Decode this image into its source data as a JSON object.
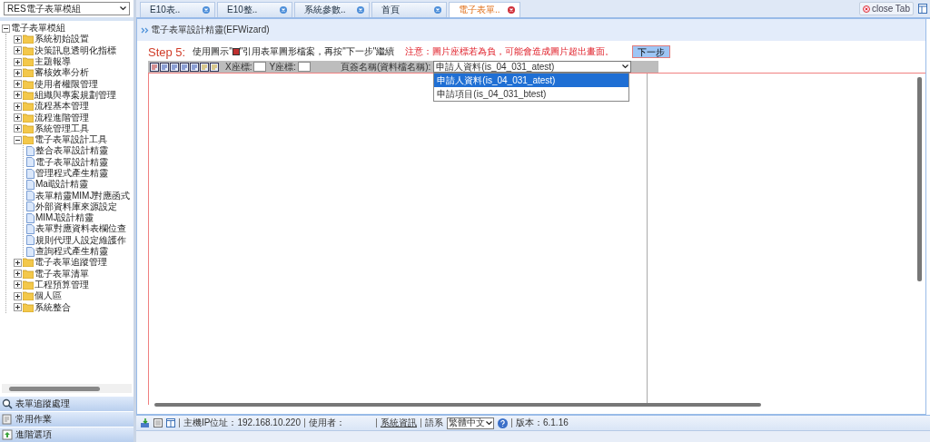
{
  "sidebar": {
    "module_select": "RES電子表單模組",
    "tree": [
      {
        "label": "電子表單模組",
        "kind": "root",
        "expanded": true,
        "children": [
          {
            "label": "系統初始設置",
            "kind": "folder",
            "expanded": false
          },
          {
            "label": "決策訊息透明化指標",
            "kind": "folder",
            "expanded": false
          },
          {
            "label": "主題報導",
            "kind": "folder",
            "expanded": false
          },
          {
            "label": "審核效率分析",
            "kind": "folder",
            "expanded": false
          },
          {
            "label": "使用者權限管理",
            "kind": "folder",
            "expanded": false
          },
          {
            "label": "組織與專案規劃管理",
            "kind": "folder",
            "expanded": false
          },
          {
            "label": "流程基本管理",
            "kind": "folder",
            "expanded": false
          },
          {
            "label": "流程進階管理",
            "kind": "folder",
            "expanded": false
          },
          {
            "label": "系統管理工具",
            "kind": "folder",
            "expanded": false
          },
          {
            "label": "電子表單設計工具",
            "kind": "folder",
            "expanded": true,
            "children": [
              {
                "label": "整合表單設計精靈",
                "kind": "file"
              },
              {
                "label": "電子表單設計精靈",
                "kind": "file"
              },
              {
                "label": "管理程式產生精靈",
                "kind": "file"
              },
              {
                "label": "Mail設計精靈",
                "kind": "file"
              },
              {
                "label": "表單精靈MIMJ對應函式",
                "kind": "file"
              },
              {
                "label": "外部資料庫來源設定",
                "kind": "file"
              },
              {
                "label": "MIMJ設計精靈",
                "kind": "file"
              },
              {
                "label": "表單對應資料表欄位查",
                "kind": "file"
              },
              {
                "label": "規則代理人設定維護作",
                "kind": "file"
              },
              {
                "label": "查詢程式產生精靈",
                "kind": "file"
              }
            ]
          },
          {
            "label": "電子表單追蹤管理",
            "kind": "folder",
            "expanded": false
          },
          {
            "label": "電子表單清單",
            "kind": "folder",
            "expanded": false
          },
          {
            "label": "工程預算管理",
            "kind": "folder",
            "expanded": false
          },
          {
            "label": "個人區",
            "kind": "folder",
            "expanded": false
          },
          {
            "label": "系統整合",
            "kind": "folder",
            "expanded": false
          }
        ]
      }
    ],
    "panels": [
      {
        "label": "表單追蹤處理"
      },
      {
        "label": "常用作業"
      },
      {
        "label": "進階選項"
      }
    ]
  },
  "tabs": [
    {
      "label": "E10表..",
      "selected": false
    },
    {
      "label": "E10整..",
      "selected": false
    },
    {
      "label": "系統參數..",
      "selected": false
    },
    {
      "label": "首頁",
      "selected": false
    },
    {
      "label": "電子表單..",
      "selected": true
    }
  ],
  "close_tab": "close Tab",
  "breadcrumb": "電子表單設計精靈(EFWizard)",
  "step": {
    "label": "Step 5:",
    "instruction_before": "使用圖示\"",
    "instruction_after": "\"引用表單圖形檔案，再按\"下一步\"繼續",
    "warning": "注意：圖片座標若為負，可能會造成圖片超出畫面。",
    "next_button": "下一步"
  },
  "toolbar": {
    "x_label": "X座標:",
    "y_label": "Y座標:",
    "sheet_label": "頁簽名稱(資料檔名稱):",
    "sheet_value": "申請人資料(is_04_031_atest)",
    "options": [
      {
        "label": "申請人資料(is_04_031_atest)",
        "selected": true
      },
      {
        "label": "申請項目(is_04_031_btest)",
        "selected": false
      }
    ]
  },
  "status_bar": {
    "ip": "主機IP位址：192.168.10.220",
    "user": "使用者：",
    "info_link": "系統資訊",
    "language_label": "語系",
    "language": "繁體中文",
    "version": "版本：6.1.16"
  }
}
